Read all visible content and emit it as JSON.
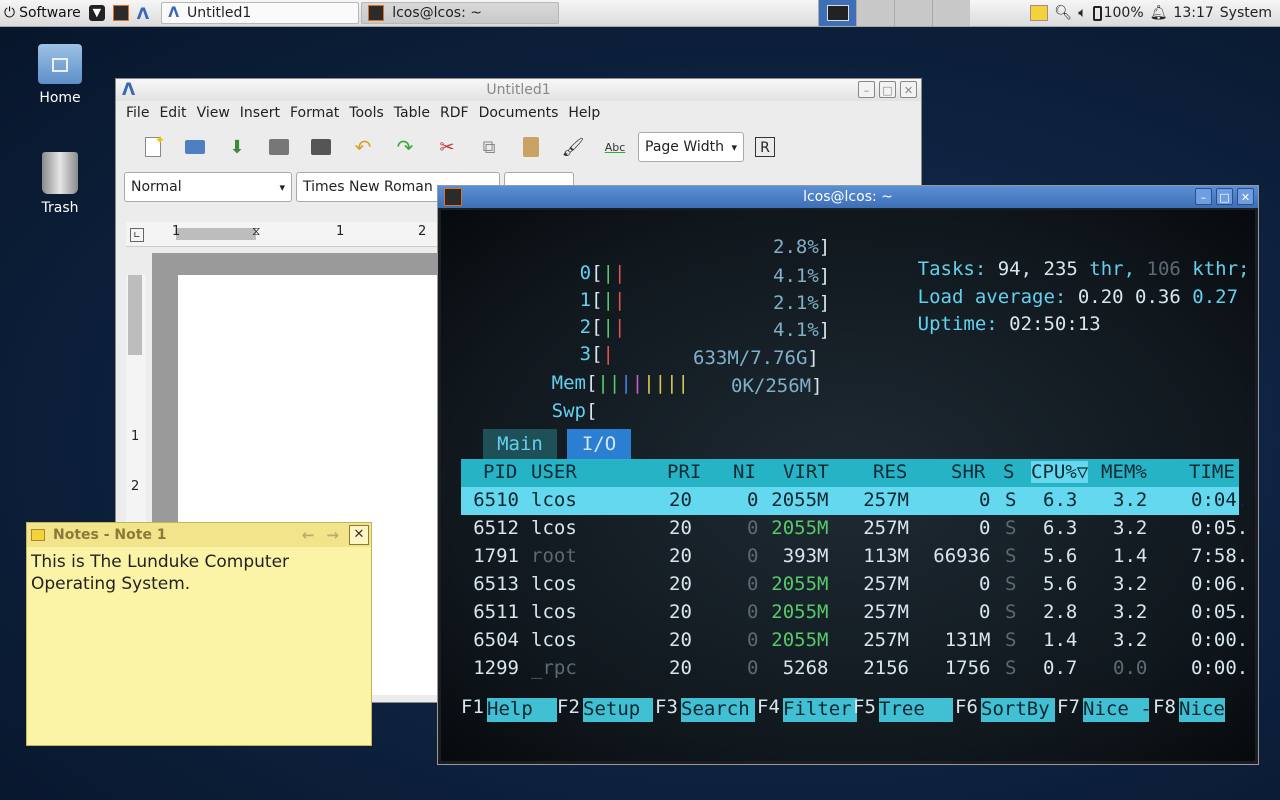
{
  "panel": {
    "menu_label": "Software",
    "tasks": [
      {
        "label": "Untitled1"
      },
      {
        "label": "lcos@lcos: ~"
      }
    ],
    "battery": "100%",
    "clock": "13:17",
    "system_label": "System"
  },
  "desktop": {
    "icons": [
      {
        "label": "Home"
      },
      {
        "label": "Trash"
      }
    ]
  },
  "abiword": {
    "title": "Untitled1",
    "menu": [
      "File",
      "Edit",
      "View",
      "Insert",
      "Format",
      "Tools",
      "Table",
      "RDF",
      "Documents",
      "Help"
    ],
    "zoom": "Page Width",
    "style": "Normal",
    "font": "Times New Roman",
    "ruler": [
      "1",
      "1",
      "2"
    ],
    "vruler": [
      "1",
      "2"
    ]
  },
  "terminal": {
    "title": "lcos@lcos: ~",
    "cpus": [
      {
        "id": "0",
        "pct": "2.8%"
      },
      {
        "id": "1",
        "pct": "4.1%"
      },
      {
        "id": "2",
        "pct": "2.1%"
      },
      {
        "id": "3",
        "pct": "4.1%"
      }
    ],
    "mem_label": "Mem",
    "mem_value": "633M/7.76G",
    "swp_label": "Swp",
    "swp_value": "0K/256M",
    "tasks_label": "Tasks:",
    "tasks_value": "94,",
    "thr_value": "235",
    "thr_label": "thr,",
    "kthr_value": "106",
    "kthr_label": "kthr;",
    "load_label": "Load average:",
    "load_1": "0.20",
    "load_5": "0.36",
    "load_15": "0.27",
    "uptime_label": "Uptime:",
    "uptime_value": "02:50:13",
    "tabs": [
      "Main",
      "I/O"
    ],
    "columns": [
      "PID",
      "USER",
      "PRI",
      "NI",
      "VIRT",
      "RES",
      "SHR",
      "S",
      "CPU%▽",
      "MEM%",
      "TIME"
    ],
    "processes": [
      {
        "pid": "6510",
        "user": "lcos",
        "pri": "20",
        "ni": "0",
        "virt": "2055M",
        "res": "257M",
        "shr": "0",
        "s": "S",
        "cpu": "6.3",
        "mem": "3.2",
        "time": "0:04."
      },
      {
        "pid": "6512",
        "user": "lcos",
        "pri": "20",
        "ni": "0",
        "virt": "2055M",
        "res": "257M",
        "shr": "0",
        "s": "S",
        "cpu": "6.3",
        "mem": "3.2",
        "time": "0:05."
      },
      {
        "pid": "1791",
        "user": "root",
        "pri": "20",
        "ni": "0",
        "virt": "393M",
        "res": "113M",
        "shr": "66936",
        "s": "S",
        "cpu": "5.6",
        "mem": "1.4",
        "time": "7:58."
      },
      {
        "pid": "6513",
        "user": "lcos",
        "pri": "20",
        "ni": "0",
        "virt": "2055M",
        "res": "257M",
        "shr": "0",
        "s": "S",
        "cpu": "5.6",
        "mem": "3.2",
        "time": "0:06."
      },
      {
        "pid": "6511",
        "user": "lcos",
        "pri": "20",
        "ni": "0",
        "virt": "2055M",
        "res": "257M",
        "shr": "0",
        "s": "S",
        "cpu": "2.8",
        "mem": "3.2",
        "time": "0:05."
      },
      {
        "pid": "6504",
        "user": "lcos",
        "pri": "20",
        "ni": "0",
        "virt": "2055M",
        "res": "257M",
        "shr": "131M",
        "s": "S",
        "cpu": "1.4",
        "mem": "3.2",
        "time": "0:00."
      },
      {
        "pid": "1299",
        "user": "_rpc",
        "pri": "20",
        "ni": "0",
        "virt": "5268",
        "res": "2156",
        "shr": "1756",
        "s": "S",
        "cpu": "0.7",
        "mem": "0.0",
        "time": "0:00."
      }
    ],
    "fkeys": [
      {
        "key": "F1",
        "label": "Help"
      },
      {
        "key": "F2",
        "label": "Setup"
      },
      {
        "key": "F3",
        "label": "Search"
      },
      {
        "key": "F4",
        "label": "Filter"
      },
      {
        "key": "F5",
        "label": "Tree"
      },
      {
        "key": "F6",
        "label": "SortBy"
      },
      {
        "key": "F7",
        "label": "Nice -"
      },
      {
        "key": "F8",
        "label": "Nice"
      }
    ]
  },
  "notes": {
    "title": "Notes - Note 1",
    "body": "This is The Lunduke Computer Operating System."
  }
}
